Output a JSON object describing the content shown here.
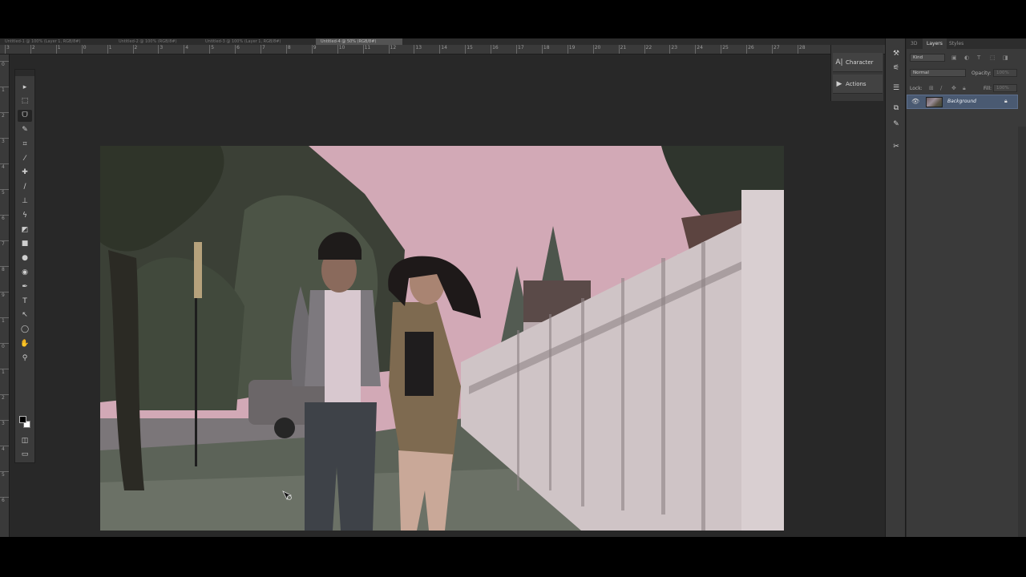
{
  "document_tabs": [
    {
      "label": "Untitled-1 @ 100% (Layer 1, RGB/8#)",
      "active": false
    },
    {
      "label": "Untitled-2 @ 100% (RGB/8#)",
      "active": false
    },
    {
      "label": "Untitled-3 @ 100% (Layer 1, RGB/8#)",
      "active": false
    },
    {
      "label": "Untitled-4 @ 50% (RGB/8#)",
      "active": true
    }
  ],
  "ruler_top": [
    "3",
    "2",
    "1",
    "0",
    "1",
    "2",
    "3",
    "4",
    "5",
    "6",
    "7",
    "8",
    "9",
    "10",
    "11",
    "12",
    "13",
    "14",
    "15",
    "16",
    "17",
    "18",
    "19",
    "20",
    "21",
    "22",
    "23",
    "24",
    "25",
    "26",
    "27",
    "28"
  ],
  "ruler_left": [
    "0",
    "1",
    "2",
    "3",
    "4",
    "5",
    "6",
    "7",
    "8",
    "9",
    "1",
    "0",
    "1",
    "2",
    "3",
    "4",
    "5",
    "6"
  ],
  "tools": [
    {
      "name": "move-tool-icon",
      "glyph": "▸"
    },
    {
      "name": "marquee-tool-icon",
      "glyph": "⬚"
    },
    {
      "name": "lasso-tool-icon",
      "glyph": "ᗜ"
    },
    {
      "name": "quick-select-tool-icon",
      "glyph": "✎"
    },
    {
      "name": "crop-tool-icon",
      "glyph": "⌗"
    },
    {
      "name": "eyedropper-tool-icon",
      "glyph": "⁄"
    },
    {
      "name": "healing-brush-tool-icon",
      "glyph": "✚"
    },
    {
      "name": "brush-tool-icon",
      "glyph": "∕"
    },
    {
      "name": "clone-stamp-tool-icon",
      "glyph": "⊥"
    },
    {
      "name": "history-brush-tool-icon",
      "glyph": "ϟ"
    },
    {
      "name": "eraser-tool-icon",
      "glyph": "◩"
    },
    {
      "name": "gradient-tool-icon",
      "glyph": "■"
    },
    {
      "name": "blur-tool-icon",
      "glyph": "●"
    },
    {
      "name": "dodge-tool-icon",
      "glyph": "◉"
    },
    {
      "name": "pen-tool-icon",
      "glyph": "✒"
    },
    {
      "name": "type-tool-icon",
      "glyph": "T"
    },
    {
      "name": "path-select-tool-icon",
      "glyph": "↖"
    },
    {
      "name": "shape-tool-icon",
      "glyph": "◯"
    },
    {
      "name": "hand-tool-icon",
      "glyph": "✋"
    },
    {
      "name": "zoom-tool-icon",
      "glyph": "⚲"
    }
  ],
  "mini_panels": {
    "character": {
      "label": "Character",
      "icon": "A|"
    },
    "actions": {
      "label": "Actions",
      "icon": "▶"
    }
  },
  "layers_panel": {
    "tabs": [
      {
        "label": "3D",
        "active": false
      },
      {
        "label": "Layers",
        "active": true
      },
      {
        "label": "Styles",
        "active": false
      }
    ],
    "kind_filter": "Kind",
    "blend_mode": "Normal",
    "opacity_label": "Opacity:",
    "opacity_value": "100%",
    "lock_label": "Lock:",
    "fill_label": "Fill:",
    "fill_value": "100%",
    "layer_name": "Background"
  }
}
